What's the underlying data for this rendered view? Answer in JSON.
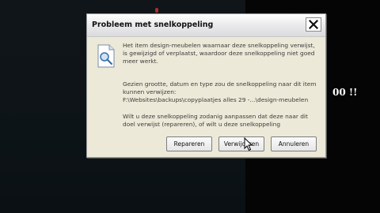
{
  "dialog": {
    "title": "Probleem met snelkoppeling",
    "message_paragraph1": "Het item design-meubelen waarnaar deze snelkoppeling verwijst, is gewijzigd of verplaatst, waardoor deze snelkoppeling niet goed meer werkt.",
    "message_paragraph2_line1": "Gezien grootte, datum en type zou de snelkoppeling naar dit item kunnen verwijzen:",
    "message_paragraph2_path": "F:\\Websites\\backups\\copyplaatjes alles 29 -...\\design-meubelen",
    "message_paragraph3": "Wilt u deze snelkoppeling zodanig aanpassen dat deze naar dit doel verwijst (repareren), of wilt u deze snelkoppeling",
    "buttons": {
      "repair": "Repareren",
      "delete": "Verwijderen",
      "cancel": "Annuleren"
    }
  },
  "background_text": "00 !!",
  "icons": {
    "close": "close-icon",
    "document": "document-search-icon",
    "cursor": "mouse-pointer-icon"
  },
  "colors": {
    "dialog_bg": "#ece9d8",
    "desktop_bg": "#0d1418"
  }
}
